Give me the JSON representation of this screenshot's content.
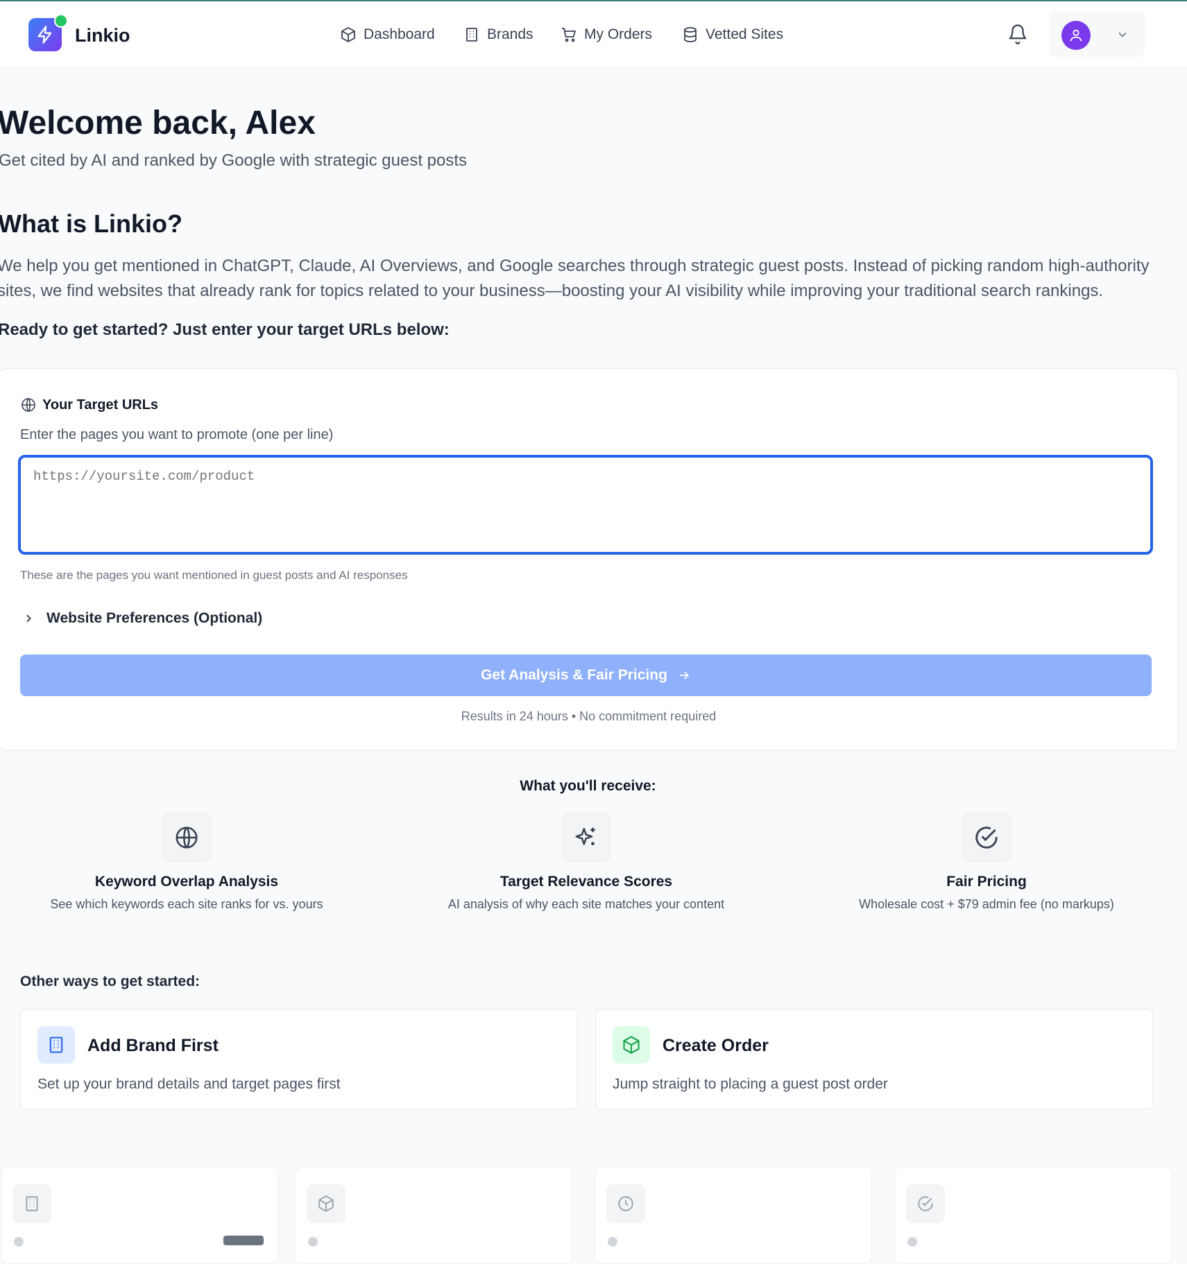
{
  "app": {
    "name": "Linkio"
  },
  "nav": {
    "items": [
      {
        "label": "Dashboard",
        "icon": "package-icon"
      },
      {
        "label": "Brands",
        "icon": "building-icon"
      },
      {
        "label": "My Orders",
        "icon": "cart-icon"
      },
      {
        "label": "Vetted Sites",
        "icon": "database-icon"
      }
    ]
  },
  "header": {
    "title": "Welcome back, Alex",
    "subtitle": "Get cited by AI and ranked by Google with strategic guest posts"
  },
  "intro": {
    "heading": "What is Linkio?",
    "body": "We help you get mentioned in ChatGPT, Claude, AI Overviews, and Google searches through strategic guest posts. Instead of picking random high-authority sites, we find websites that already rank for topics related to your business—boosting your AI visibility while improving your traditional search rankings.",
    "ready": "Ready to get started? Just enter your target URLs below:"
  },
  "form": {
    "title": "Your Target URLs",
    "description": "Enter the pages you want to promote (one per line)",
    "placeholder": "https://yoursite.com/product",
    "value": "",
    "help": "These are the pages you want mentioned in guest posts and AI responses",
    "preferences_label": "Website Preferences (Optional)",
    "cta_label": "Get Analysis & Fair Pricing",
    "results_note": "Results in 24 hours • No commitment required"
  },
  "receive": {
    "heading": "What you'll receive:",
    "features": [
      {
        "title": "Keyword Overlap Analysis",
        "desc": "See which keywords each site ranks for vs. yours",
        "icon": "globe-icon"
      },
      {
        "title": "Target Relevance Scores",
        "desc": "AI analysis of why each site matches your content",
        "icon": "sparkles-icon"
      },
      {
        "title": "Fair Pricing",
        "desc": "Wholesale cost + $79 admin fee (no markups)",
        "icon": "check-circle-icon"
      }
    ]
  },
  "other": {
    "heading": "Other ways to get started:",
    "options": [
      {
        "title": "Add Brand First",
        "desc": "Set up your brand details and target pages first",
        "icon": "building-icon",
        "color": "#2563eb"
      },
      {
        "title": "Create Order",
        "desc": "Jump straight to placing a guest post order",
        "icon": "package-icon",
        "color": "#16a34a"
      }
    ]
  },
  "colors": {
    "accent": "#2563eb",
    "cta": "#8fb0fb",
    "brand_gradient_start": "#3b82f6",
    "brand_gradient_end": "#7c3aed",
    "status_online": "#22c55e"
  }
}
